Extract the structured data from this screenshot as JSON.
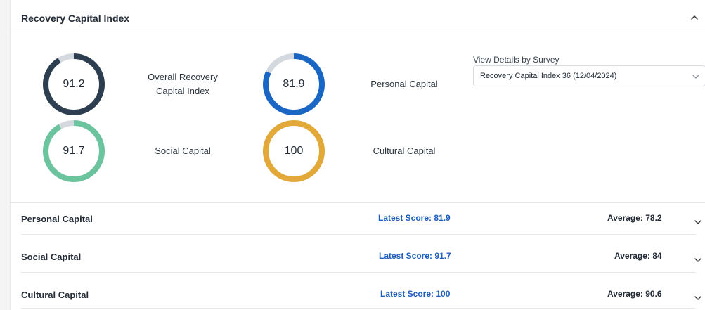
{
  "header": {
    "title": "Recovery Capital Index"
  },
  "gauges": [
    {
      "value": "91.2",
      "label_line1": "Overall Recovery",
      "label_line2": "Capital Index",
      "fraction": 0.912,
      "color": "#2c3e50",
      "track": "#d4d9df"
    },
    {
      "value": "81.9",
      "label_line1": "Personal Capital",
      "label_line2": "",
      "fraction": 0.819,
      "color": "#1a66c4",
      "track": "#d4d9df"
    },
    {
      "value": "91.7",
      "label_line1": "Social Capital",
      "label_line2": "",
      "fraction": 0.917,
      "color": "#6cc49e",
      "track": "#d4d9df"
    },
    {
      "value": "100",
      "label_line1": "Cultural Capital",
      "label_line2": "",
      "fraction": 1.0,
      "color": "#e2a838",
      "track": "#d4d9df"
    }
  ],
  "survey": {
    "label": "View Details by Survey",
    "selected": "Recovery Capital Index 36 (12/04/2024)"
  },
  "rows": [
    {
      "title": "Personal Capital",
      "latest": "Latest Score: 81.9",
      "average": "Average: 78.2"
    },
    {
      "title": "Social Capital",
      "latest": "Latest Score: 91.7",
      "average": "Average: 84"
    },
    {
      "title": "Cultural Capital",
      "latest": "Latest Score: 100",
      "average": "Average: 90.6"
    }
  ],
  "icons": {
    "collapse": "chevron-up-icon",
    "expand": "chevron-down-icon",
    "select": "chevron-down-icon"
  }
}
